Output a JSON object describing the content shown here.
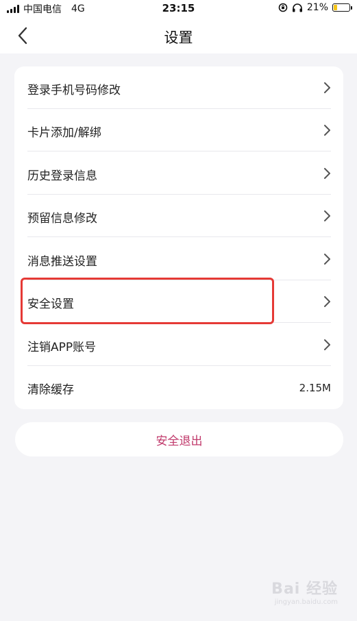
{
  "status_bar": {
    "carrier": "中国电信",
    "network": "4G",
    "time": "23:15",
    "battery_percent": "21%",
    "battery_level": 0.21
  },
  "header": {
    "title": "设置"
  },
  "menu": {
    "items": [
      {
        "label": "登录手机号码修改",
        "icon": "chevron-right-icon"
      },
      {
        "label": "卡片添加/解绑",
        "icon": "chevron-right-icon"
      },
      {
        "label": "历史登录信息",
        "icon": "chevron-right-icon"
      },
      {
        "label": "预留信息修改",
        "icon": "chevron-right-icon"
      },
      {
        "label": "消息推送设置",
        "icon": "chevron-right-icon"
      },
      {
        "label": "安全设置",
        "icon": "chevron-right-icon",
        "highlighted": true
      },
      {
        "label": "注销APP账号",
        "icon": "chevron-right-icon"
      },
      {
        "label": "清除缓存",
        "value": "2.15M"
      }
    ]
  },
  "logout": {
    "label": "安全退出"
  },
  "watermark": {
    "logo": "Bai 经验",
    "sub": "jingyan.baidu.com"
  },
  "colors": {
    "page_bg": "#f4f4f7",
    "card_bg": "#ffffff",
    "logout_text": "#c0396b",
    "highlight_border": "#e53935",
    "battery_fill": "#f5c518"
  }
}
